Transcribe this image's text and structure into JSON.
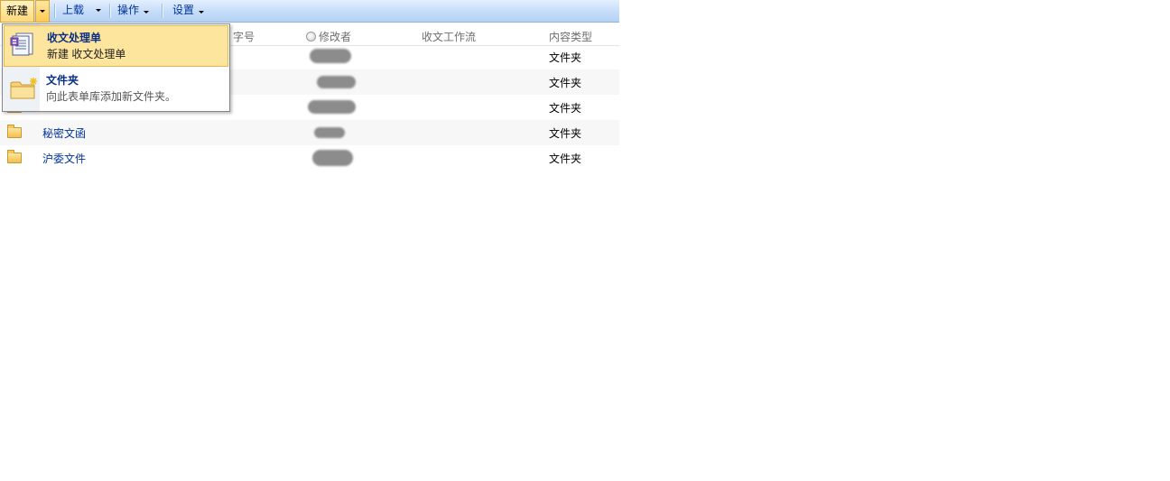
{
  "toolbar": {
    "new_label": "新建",
    "upload_label": "上载",
    "actions_label": "操作",
    "settings_label": "设置"
  },
  "columns": {
    "seq": "字号",
    "modifier": "修改者",
    "workflow": "收文工作流",
    "content_type": "内容类型"
  },
  "rows": [
    {
      "name": "",
      "content_type": "文件夹"
    },
    {
      "name": "",
      "content_type": "文件夹"
    },
    {
      "name": "",
      "content_type": "文件夹"
    },
    {
      "name": "秘密文函",
      "content_type": "文件夹"
    },
    {
      "name": "沪委文件",
      "content_type": "文件夹"
    }
  ],
  "menu": {
    "items": [
      {
        "title": "收文处理单",
        "desc": "新建 收文处理单",
        "icon": "document-form-icon"
      },
      {
        "title": "文件夹",
        "desc": "向此表单库添加新文件夹。",
        "icon": "new-folder-icon"
      }
    ]
  },
  "colors": {
    "link": "#003399",
    "menu_highlight": "#fde59e",
    "toolbar": "#c4dcf8"
  }
}
